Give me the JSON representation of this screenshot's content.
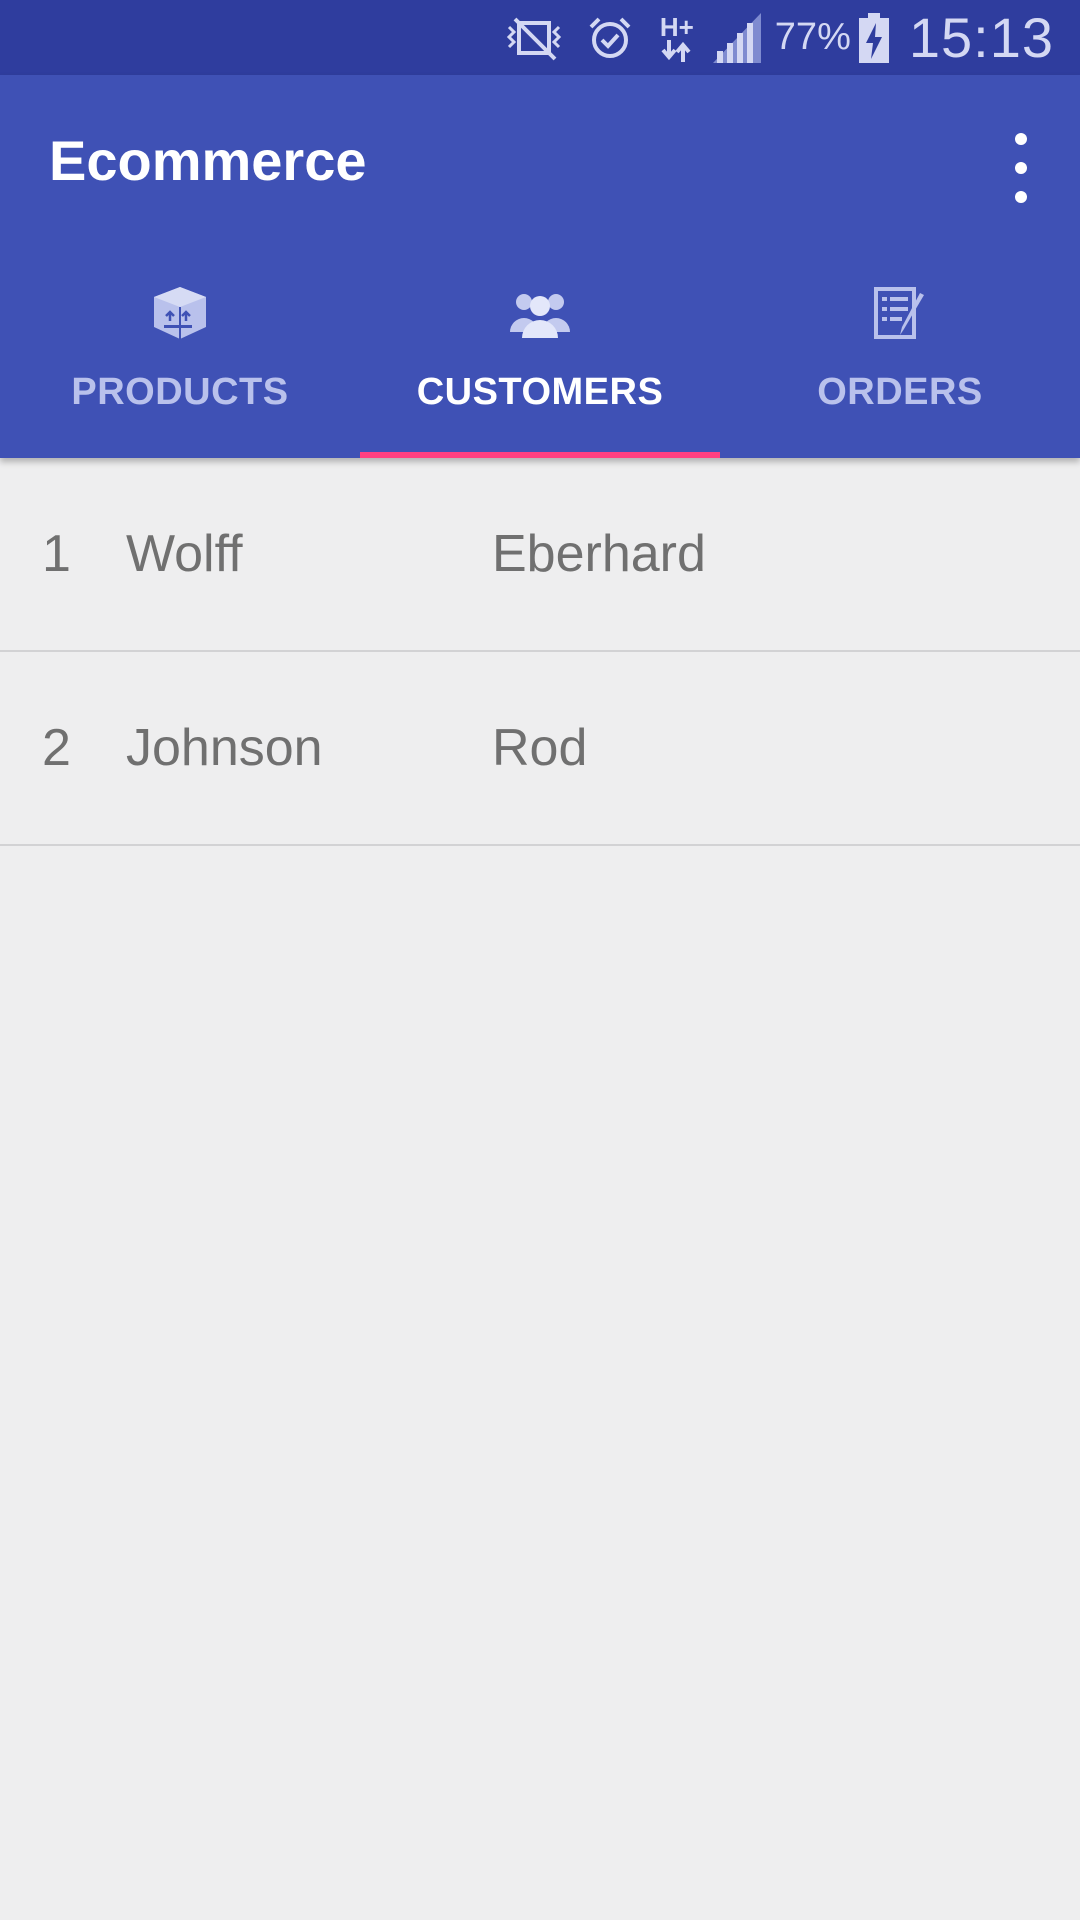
{
  "status_bar": {
    "icons": [
      "vibrate-mute-icon",
      "alarm-icon",
      "hplus-network-icon",
      "signal-icon",
      "battery-charging-icon"
    ],
    "network_type": "H+",
    "battery": "77%",
    "time": "15:13"
  },
  "app": {
    "title": "Ecommerce",
    "primary_color": "#3f51b5",
    "status_bar_color": "#2f3d9e",
    "accent_color": "#ff4081"
  },
  "tabs": [
    {
      "label": "PRODUCTS",
      "icon": "box-icon",
      "active": false
    },
    {
      "label": "CUSTOMERS",
      "icon": "people-icon",
      "active": true
    },
    {
      "label": "ORDERS",
      "icon": "order-list-icon",
      "active": false
    }
  ],
  "customers": [
    {
      "id": "1",
      "last_name": "Wolff",
      "first_name": "Eberhard"
    },
    {
      "id": "2",
      "last_name": "Johnson",
      "first_name": "Rod"
    }
  ]
}
